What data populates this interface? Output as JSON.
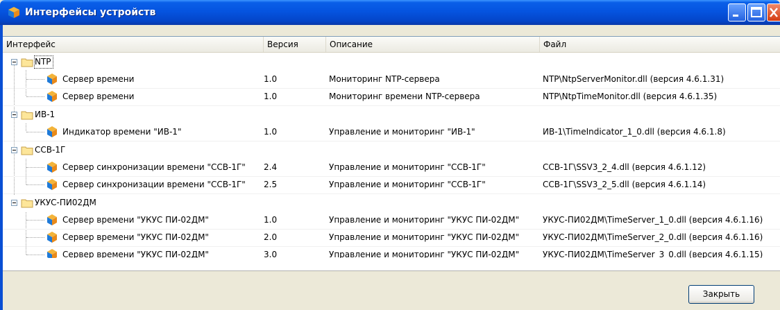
{
  "window": {
    "title": "Интерфейсы устройств"
  },
  "columns": {
    "interface": "Интерфейс",
    "version": "Версия",
    "description": "Описание",
    "file": "Файл"
  },
  "groups": [
    {
      "name": "NTP",
      "items": [
        {
          "interface": "Сервер времени",
          "version": "1.0",
          "description": "Мониторинг NTP-сервера",
          "file": "NTP\\NtpServerMonitor.dll (версия 4.6.1.31)"
        },
        {
          "interface": "Сервер времени",
          "version": "1.0",
          "description": "Мониторинг времени NTP-сервера",
          "file": "NTP\\NtpTimeMonitor.dll (версия 4.6.1.35)"
        }
      ]
    },
    {
      "name": "ИВ-1",
      "items": [
        {
          "interface": "Индикатор времени \"ИВ-1\"",
          "version": "1.0",
          "description": "Управление и мониторинг \"ИВ-1\"",
          "file": "ИВ-1\\TimeIndicator_1_0.dll (версия 4.6.1.8)"
        }
      ]
    },
    {
      "name": "ССВ-1Г",
      "items": [
        {
          "interface": "Сервер синхронизации времени \"ССВ-1Г\"",
          "version": "2.4",
          "description": "Управление и мониторинг \"ССВ-1Г\"",
          "file": "ССВ-1Г\\SSV3_2_4.dll (версия 4.6.1.12)"
        },
        {
          "interface": "Сервер синхронизации времени \"ССВ-1Г\"",
          "version": "2.5",
          "description": "Управление и мониторинг \"ССВ-1Г\"",
          "file": "ССВ-1Г\\SSV3_2_5.dll (версия 4.6.1.14)"
        }
      ]
    },
    {
      "name": "УКУС-ПИ02ДМ",
      "items": [
        {
          "interface": "Сервер времени \"УКУС ПИ-02ДМ\"",
          "version": "1.0",
          "description": "Управление и мониторинг \"УКУС ПИ-02ДМ\"",
          "file": "УКУС-ПИ02ДМ\\TimeServer_1_0.dll (версия 4.6.1.16)"
        },
        {
          "interface": "Сервер времени \"УКУС ПИ-02ДМ\"",
          "version": "2.0",
          "description": "Управление и мониторинг \"УКУС ПИ-02ДМ\"",
          "file": "УКУС-ПИ02ДМ\\TimeServer_2_0.dll (версия 4.6.1.16)"
        },
        {
          "interface": "Сервер времени \"УКУС ПИ-02ДМ\"",
          "version": "3.0",
          "description": "Управление и мониторинг \"УКУС ПИ-02ДМ\"",
          "file": "УКУС-ПИ02ДМ\\TimeServer_3_0.dll (версия 4.6.1.15)"
        }
      ]
    }
  ],
  "footer": {
    "close_label": "Закрыть"
  },
  "icons": {
    "title": "package-icon",
    "window_controls": [
      "minimize-icon",
      "maximize-icon",
      "close-icon"
    ],
    "group": "folder-icon",
    "item": "component-icon",
    "expander": "collapse-icon"
  }
}
